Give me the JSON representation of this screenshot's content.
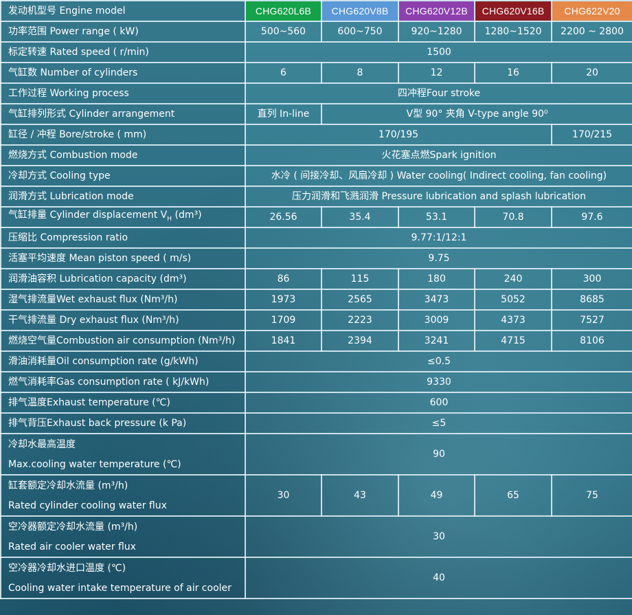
{
  "header": {
    "label": "发动机型号  Engine model",
    "models": [
      "CHG620L6B",
      "CHG620V8B",
      "CHG620V12B",
      "CHG620V16B",
      "CHG622V20"
    ],
    "colors": [
      "#16a24a",
      "#5a98d8",
      "#8d3fae",
      "#8c1c22",
      "#e4894a"
    ]
  },
  "rows": {
    "power": {
      "label": "功率范围    Power range ( kW)",
      "values": [
        "500~560",
        "600~750",
        "920~1280",
        "1280~1520",
        "2200 ~ 2800"
      ]
    },
    "speed": {
      "label": "标定转速  Rated speed ( r/min)",
      "value": "1500"
    },
    "cylinders": {
      "label": "气缸数  Number of cylinders",
      "values": [
        "6",
        "8",
        "12",
        "16",
        "20"
      ]
    },
    "process": {
      "label": "工作过程  Working process",
      "value": "四冲程Four stroke"
    },
    "arrangement": {
      "label": "气缸排列形式  Cylinder arrangement",
      "inline": "直列 In-line",
      "vtype": "V型    90°  夹角    V-type angle 90⁰"
    },
    "bore": {
      "label": "缸径 / 冲程 Bore/stroke ( mm)",
      "main": "170/195",
      "v20": "170/215"
    },
    "combustion": {
      "label": "燃烧方式 Combustion mode",
      "value": "火花塞点燃Spark ignition"
    },
    "cooling": {
      "label": "冷却方式 Cooling type",
      "value": "水冷 ( 间接冷却、风扇冷却 ) Water cooling( Indirect cooling, fan cooling)"
    },
    "lubrication": {
      "label": "润滑方式 Lubrication mode",
      "value": "压力润滑和飞溅润滑 Pressure lubrication and splash lubrication"
    },
    "displacement": {
      "label_prefix": "气缸排量 Cylinder displacement V",
      "label_sub": "H",
      "label_suffix": " (dm³)",
      "values": [
        "26.56",
        "35.4",
        "53.1",
        "70.8",
        "97.6"
      ]
    },
    "compression": {
      "label": "压缩比 Compression ratio",
      "value": "9.77:1/12:1"
    },
    "piston": {
      "label": "活塞平均速度 Mean piston speed ( m/s)",
      "value": "9.75"
    },
    "oil_capacity": {
      "label": "润滑油容积 Lubrication capacity (dm³)",
      "values": [
        "86",
        "115",
        "180",
        "240",
        "300"
      ]
    },
    "wet_exhaust": {
      "label": "湿气排流量Wet exhaust flux (Nm³/h)",
      "values": [
        "1973",
        "2565",
        "3473",
        "5052",
        "8685"
      ]
    },
    "dry_exhaust": {
      "label": "干气排流量 Dry exhaust flux (Nm³/h)",
      "values": [
        "1709",
        "2223",
        "3009",
        "4373",
        "7527"
      ]
    },
    "air_consumption": {
      "label": "燃烧空气量Combustion air consumption (Nm³/h)",
      "values": [
        "1841",
        "2394",
        "3241",
        "4715",
        "8106"
      ]
    },
    "oil_consumption": {
      "label": "滑油消耗量Oil consumption rate (g/kWh)",
      "value": "≤0.5"
    },
    "gas_consumption": {
      "label": "燃气消耗率Gas consumption rate ( kJ/kWh)",
      "value": "9330"
    },
    "exhaust_temp": {
      "label": "排气温度Exhaust temperature (℃)",
      "value": "600"
    },
    "back_pressure": {
      "label": "排气背压Exhaust back pressure (k Pa)",
      "value": "≤5"
    },
    "max_water_temp": {
      "label_cn": "冷却水最高温度",
      "label_en": "Max.cooling water temperature (℃)",
      "value": "90"
    },
    "cyl_water_flux": {
      "label_cn": "缸套额定冷却水流量 (m³/h)",
      "label_en": "Rated cylinder cooling water flux",
      "values": [
        "30",
        "43",
        "49",
        "65",
        "75"
      ]
    },
    "air_cooler_flux": {
      "label_cn": "空冷器额定冷却水流量 (m³/h)",
      "label_en": "Rated air cooler water flux",
      "value": "30"
    },
    "air_cooler_temp": {
      "label_cn": "空冷器冷却水进口温度 (℃)",
      "label_en": "Cooling water intake temperature of air cooler",
      "value": "40"
    }
  }
}
